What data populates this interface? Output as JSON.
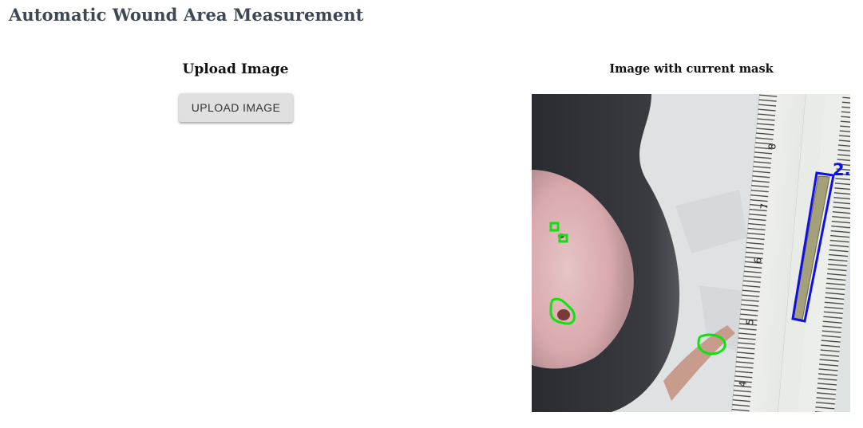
{
  "app": {
    "title": "Automatic Wound Area Measurement"
  },
  "upload": {
    "heading": "Upload Image",
    "button_label": "UPLOAD IMAGE"
  },
  "result": {
    "heading": "Image with current mask",
    "ruler_numbers": [
      "8",
      "7",
      "6",
      "5",
      "4"
    ],
    "reference_label": "2.",
    "wound_outline_color": "#11e011",
    "reference_outline_color": "#1010e6"
  }
}
